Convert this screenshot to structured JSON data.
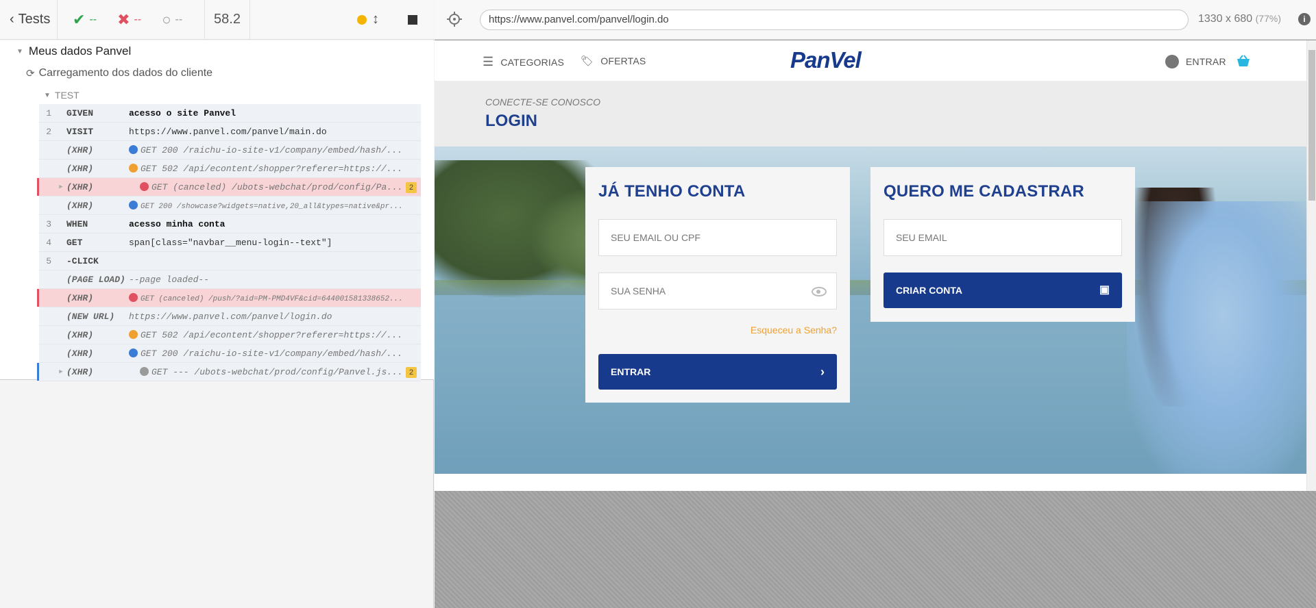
{
  "runner": {
    "back_label": "Tests",
    "passed": "--",
    "failed": "--",
    "pending": "--",
    "duration": "58.2"
  },
  "reporter": {
    "suite": "Meus dados Panvel",
    "test": "Carregamento dos dados do cliente",
    "section": "TEST",
    "commands": [
      {
        "num": "1",
        "name": "GIVEN",
        "msg": "acesso o site Panvel",
        "style": "b",
        "state": ""
      },
      {
        "num": "2",
        "name": "VISIT",
        "msg": "https://www.panvel.com/panvel/main.do",
        "style": "",
        "state": ""
      },
      {
        "num": "",
        "name": "(XHR)",
        "msg": "GET 200 /raichu-io-site-v1/company/embed/hash/...",
        "style": "it",
        "state": "",
        "dot": "#3a7cd6"
      },
      {
        "num": "",
        "name": "(XHR)",
        "msg": "GET 502 /api/econtent/shopper?referer=https://...",
        "style": "it",
        "state": "",
        "dot": "#f0a030"
      },
      {
        "num": "",
        "name": "(XHR)",
        "msg": "GET (canceled) /ubots-webchat/prod/config/Pa...",
        "style": "it",
        "state": "err",
        "dot": "#e05061",
        "badge": "2",
        "expand": true
      },
      {
        "num": "",
        "name": "(XHR)",
        "msg": "GET 200 /showcase?widgets=native,20_all&types=native&pr...",
        "style": "it",
        "state": "",
        "dot": "#3a7cd6",
        "small": true
      },
      {
        "num": "3",
        "name": "WHEN",
        "msg": "acesso minha conta",
        "style": "b",
        "state": ""
      },
      {
        "num": "4",
        "name": "GET",
        "msg": "span[class=\"navbar__menu-login--text\"]",
        "style": "",
        "state": ""
      },
      {
        "num": "5",
        "name": "-CLICK",
        "msg": "",
        "style": "",
        "state": ""
      },
      {
        "num": "",
        "name": "(PAGE LOAD)",
        "msg": "--page loaded--",
        "style": "it",
        "state": ""
      },
      {
        "num": "",
        "name": "(XHR)",
        "msg": "GET (canceled) /push/?aid=PM-PMD4VF&cid=644001581338652...",
        "style": "it",
        "state": "err",
        "dot": "#e05061",
        "small": true
      },
      {
        "num": "",
        "name": "(NEW URL)",
        "msg": "https://www.panvel.com/panvel/login.do",
        "style": "it",
        "state": ""
      },
      {
        "num": "",
        "name": "(XHR)",
        "msg": "GET 502 /api/econtent/shopper?referer=https://...",
        "style": "it",
        "state": "",
        "dot": "#f0a030"
      },
      {
        "num": "",
        "name": "(XHR)",
        "msg": "GET 200 /raichu-io-site-v1/company/embed/hash/...",
        "style": "it",
        "state": "",
        "dot": "#3a7cd6"
      },
      {
        "num": "",
        "name": "(XHR)",
        "msg": "GET --- /ubots-webchat/prod/config/Panvel.js...",
        "style": "it",
        "state": "pend",
        "dot": "#9a9a9a",
        "badge": "2",
        "expand": true
      }
    ]
  },
  "aut": {
    "url": "https://www.panvel.com/panvel/login.do",
    "viewport": "1330 x 680",
    "scale": "(77%)"
  },
  "panvel": {
    "nav_categories": "CATEGORIAS",
    "nav_offers": "OFERTAS",
    "logo": "PanVel",
    "nav_login": "ENTRAR",
    "kicker": "CONECTE-SE CONOSCO",
    "title": "LOGIN",
    "login_card": {
      "heading": "JÁ TENHO CONTA",
      "email_placeholder": "SEU EMAIL OU CPF",
      "password_placeholder": "SUA SENHA",
      "forgot": "Esqueceu a Senha?",
      "submit": "ENTRAR"
    },
    "signup_card": {
      "heading": "QUERO ME CADASTRAR",
      "email_placeholder": "SEU EMAIL",
      "submit": "CRIAR CONTA"
    }
  },
  "colors": {
    "brand_blue": "#183a8c",
    "pass_green": "#2ea44f",
    "fail_red": "#e05061",
    "accent_orange": "#f0a030"
  }
}
